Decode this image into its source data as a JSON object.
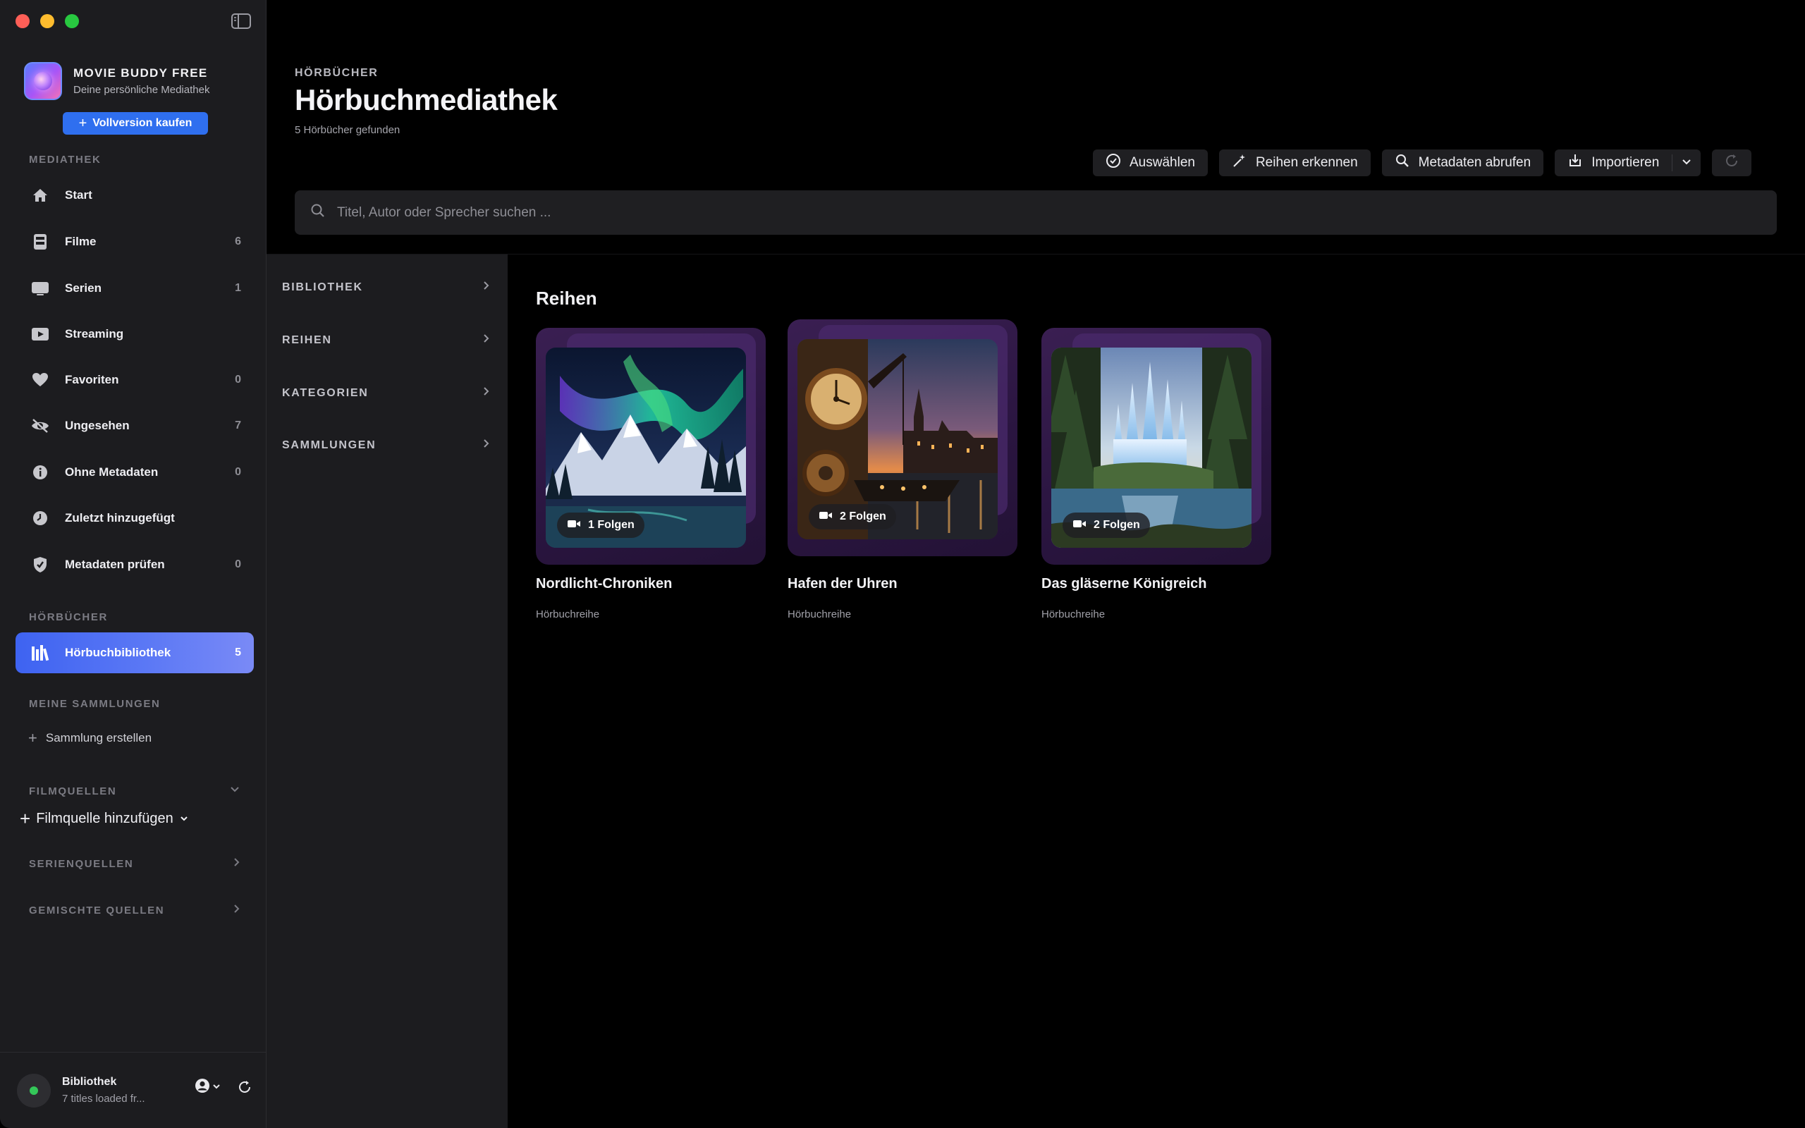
{
  "app": {
    "name": "MOVIE BUDDY FREE",
    "subtitle": "Deine persönliche Mediathek",
    "buy_label": "Vollversion kaufen"
  },
  "sidebar": {
    "section_library": "MEDIATHEK",
    "items": [
      {
        "label": "Start",
        "count": "",
        "icon": "house-icon"
      },
      {
        "label": "Filme",
        "count": "6",
        "icon": "film-icon"
      },
      {
        "label": "Serien",
        "count": "1",
        "icon": "tv-icon"
      },
      {
        "label": "Streaming",
        "count": "",
        "icon": "play-rectangle-icon"
      },
      {
        "label": "Favoriten",
        "count": "0",
        "icon": "heart-icon"
      },
      {
        "label": "Ungesehen",
        "count": "7",
        "icon": "eye-slash-icon"
      },
      {
        "label": "Ohne Metadaten",
        "count": "0",
        "icon": "info-circle-icon"
      },
      {
        "label": "Zuletzt hinzugefügt",
        "count": "",
        "icon": "clock-icon"
      },
      {
        "label": "Metadaten prüfen",
        "count": "0",
        "icon": "shield-check-icon"
      }
    ],
    "section_audiobooks": "HÖRBÜCHER",
    "audiobook_item": {
      "label": "Hörbuchbibliothek",
      "count": "5",
      "icon": "books-icon"
    },
    "section_collections": "MEINE SAMMLUNGEN",
    "create_collection": "Sammlung erstellen",
    "section_film_sources": "FILMQUELLEN",
    "add_film_source": "Filmquelle hinzufügen",
    "section_series_sources": "SERIENQUELLEN",
    "section_mixed_sources": "GEMISCHTE QUELLEN",
    "footer": {
      "title": "Bibliothek",
      "subtitle": "7 titles loaded fr..."
    }
  },
  "header": {
    "kicker": "HÖRBÜCHER",
    "title": "Hörbuchmediathek",
    "count_text": "5 Hörbücher gefunden"
  },
  "toolbar": {
    "select": "Auswählen",
    "detect_series": "Reihen erkennen",
    "fetch_metadata": "Metadaten abrufen",
    "import": "Importieren"
  },
  "search": {
    "placeholder": "Titel, Autor oder Sprecher suchen ..."
  },
  "categories": [
    {
      "label": "BIBLIOTHEK"
    },
    {
      "label": "REIHEN"
    },
    {
      "label": "KATEGORIEN"
    },
    {
      "label": "SAMMLUNGEN"
    }
  ],
  "main": {
    "heading": "Reihen",
    "cards": [
      {
        "title": "Nordlicht-Chroniken",
        "subtitle": "Hörbuchreihe",
        "badge": "1 Folgen"
      },
      {
        "title": "Hafen der Uhren",
        "subtitle": "Hörbuchreihe",
        "badge": "2 Folgen"
      },
      {
        "title": "Das gläserne Königreich",
        "subtitle": "Hörbuchreihe",
        "badge": "2 Folgen"
      }
    ]
  },
  "colors": {
    "accent": "#3e63f1",
    "buy_button": "#2f6fef",
    "sidebar_bg": "#1c1c1f",
    "card_frame": "#2a1540",
    "status_online": "#34c759"
  }
}
